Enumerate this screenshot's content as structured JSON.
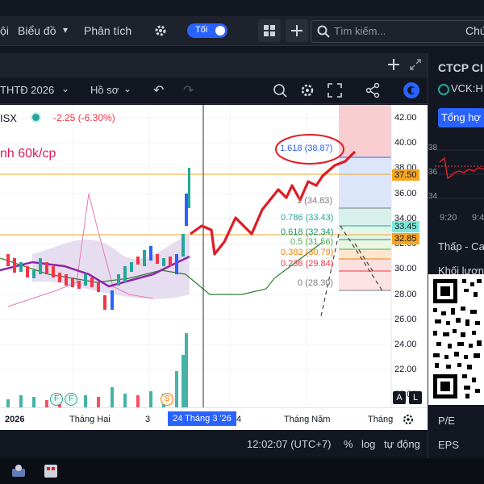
{
  "topbar": {
    "item1": "ội",
    "chart_type": "Biểu đồ",
    "analysis": "Phân tích",
    "theme": "Tối",
    "search_placeholder": "Tìm kiếm...",
    "right_text": "Chứ"
  },
  "tabs": {
    "title": "THTĐ 2026",
    "profile": "Hồ sơ"
  },
  "symbol": {
    "exchange": "ISX",
    "change": "-2.25 (-6.30%)",
    "annotation": "nh 60k/cp"
  },
  "y_ticks": [
    "42.00",
    "40.00",
    "38.00",
    "36.00",
    "34.00",
    "32.00",
    "30.00",
    "28.00",
    "26.00",
    "24.00",
    "22.00",
    "20.00"
  ],
  "price_tags": {
    "p1": "37.50",
    "p2": "33.45",
    "p3": "32.85"
  },
  "fib_levels": [
    {
      "label": "1.618 (38.87)",
      "color": "#2962ff"
    },
    {
      "label": "1 (34.83)",
      "color": "#787b86"
    },
    {
      "label": "0.786 (33.43)",
      "color": "#26a69a"
    },
    {
      "label": "0.618 (32.34)",
      "color": "#089981"
    },
    {
      "label": "0.5 (31.56)",
      "color": "#4caf50"
    },
    {
      "label": "0.382 (30.79)",
      "color": "#f57c00"
    },
    {
      "label": "0.236 (29.84)",
      "color": "#f23645"
    },
    {
      "label": "0 (28.30)",
      "color": "#787b86"
    }
  ],
  "x_ticks": {
    "t1": "2026",
    "t2": "Tháng Hai",
    "t3": "3",
    "current": "24 Tháng 3 '26",
    "t4": "4",
    "t5": "Tháng Năm",
    "t6": "Tháng"
  },
  "badges": {
    "auto": "A",
    "log": "L",
    "f1": "F",
    "f2": "F",
    "s": "S"
  },
  "statusbar": {
    "time": "12:02:07 (UTC+7)",
    "percent": "%",
    "log": "log",
    "auto": "tự động"
  },
  "right_panel": {
    "title": "CTCP CI",
    "ticker": "VCK:H",
    "overview": "Tổng hợ",
    "mini_t1": "9:20",
    "mini_t2": "9:4",
    "mini_y1": "38",
    "mini_y2": "36",
    "mini_y3": "34",
    "low_high": "Thấp - Cao",
    "volume": "Khối lượng",
    "pe": "P/E",
    "eps": "EPS"
  },
  "colors": {
    "accent": "#2962ff",
    "red": "#e01b24",
    "green": "#26a69a",
    "purple": "#8e24aa"
  }
}
